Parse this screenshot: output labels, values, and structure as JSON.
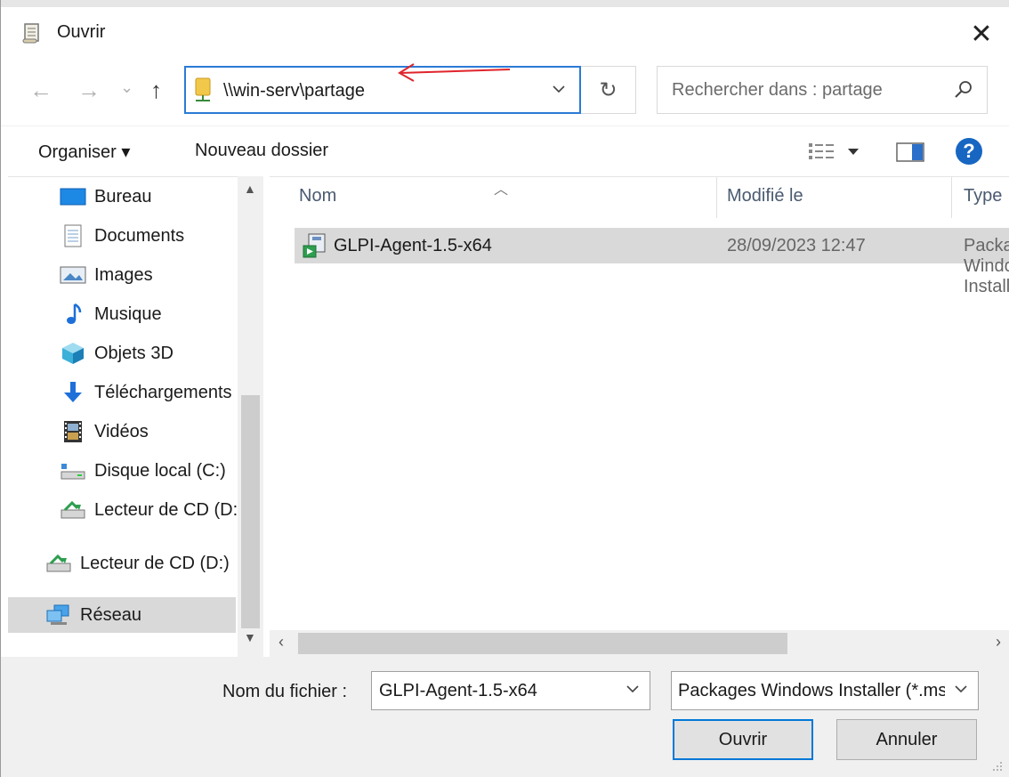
{
  "window": {
    "title": "Ouvrir",
    "close_glyph": "✕"
  },
  "address_bar": {
    "path": "\\\\win-serv\\partage",
    "icon": "network-share-icon"
  },
  "nav_buttons": {
    "back": "←",
    "forward": "→",
    "recent": "⌄",
    "up": "↑",
    "refresh": "↻"
  },
  "search": {
    "placeholder": "Rechercher dans : partage"
  },
  "toolbar": {
    "organise_label": "Organiser ▾",
    "new_folder_label": "Nouveau dossier",
    "help": "?"
  },
  "sidebar": {
    "items": [
      {
        "label": "Bureau",
        "icon": "desktop-icon"
      },
      {
        "label": "Documents",
        "icon": "documents-icon"
      },
      {
        "label": "Images",
        "icon": "pictures-icon"
      },
      {
        "label": "Musique",
        "icon": "music-icon"
      },
      {
        "label": "Objets 3D",
        "icon": "3d-objects-icon"
      },
      {
        "label": "Téléchargements",
        "icon": "downloads-icon"
      },
      {
        "label": "Vidéos",
        "icon": "videos-icon"
      },
      {
        "label": "Disque local (C:)",
        "icon": "local-disk-icon"
      },
      {
        "label": "Lecteur de CD (D:)",
        "icon": "cd-drive-icon"
      },
      {
        "label": "Lecteur de CD (D:)",
        "icon": "cd-drive-icon"
      },
      {
        "label": "Réseau",
        "icon": "network-icon"
      }
    ]
  },
  "file_list": {
    "columns": [
      "Nom",
      "Modifié le",
      "Type"
    ],
    "rows": [
      {
        "name": "GLPI-Agent-1.5-x64",
        "modified": "28/09/2023 12:47",
        "type": "Package Windows Installer",
        "icon": "msi-package-icon"
      }
    ]
  },
  "footer": {
    "filename_label": "Nom du fichier :",
    "filename_value": "GLPI-Agent-1.5-x64",
    "filetype_value": "Packages Windows Installer (*.msi)",
    "open_label": "Ouvrir",
    "cancel_label": "Annuler"
  },
  "colors": {
    "accent": "#0078d7",
    "selection": "#d9d9d9",
    "annotation_arrow": "#e0242b"
  }
}
